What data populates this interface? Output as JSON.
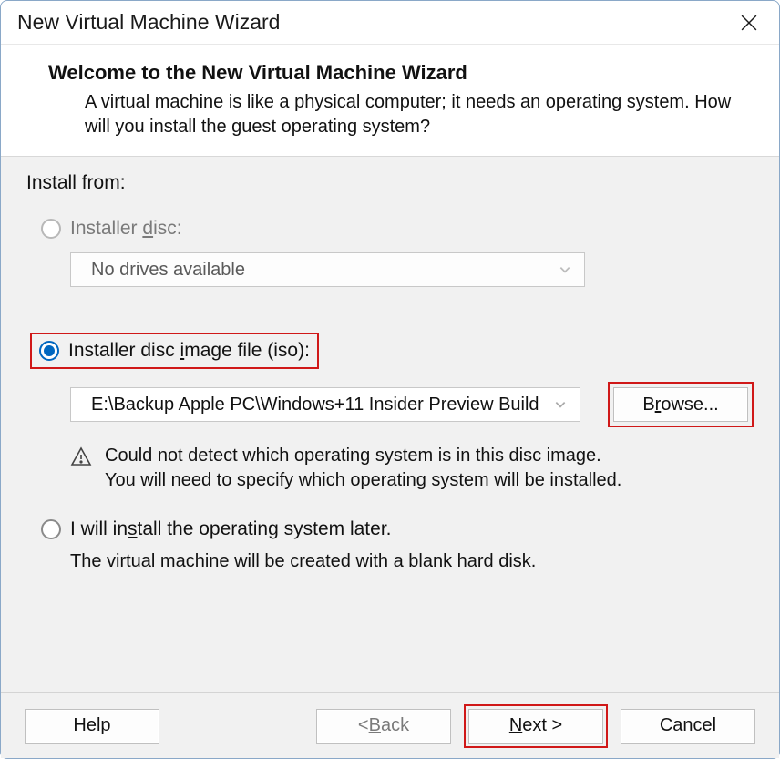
{
  "window": {
    "title": "New Virtual Machine Wizard"
  },
  "header": {
    "title": "Welcome to the New Virtual Machine Wizard",
    "description": "A virtual machine is like a physical computer; it needs an operating system. How will you install the guest operating system?"
  },
  "content": {
    "install_from_label": "Install from:",
    "disc": {
      "label_pre": "Installer ",
      "label_ul": "d",
      "label_post": "isc:",
      "select_value": "No drives available"
    },
    "iso": {
      "label_pre": "Installer disc ",
      "label_ul": "i",
      "label_post": "mage file (iso):",
      "select_value": "E:\\Backup Apple PC\\Windows+11 Insider Preview Build",
      "browse_pre": "B",
      "browse_ul": "r",
      "browse_post": "owse...",
      "warn_line1": "Could not detect which operating system is in this disc image.",
      "warn_line2": "You will need to specify which operating system will be installed."
    },
    "later": {
      "label_pre": "I will in",
      "label_ul": "s",
      "label_post": "tall the operating system later.",
      "info": "The virtual machine will be created with a blank hard disk."
    }
  },
  "footer": {
    "help": "Help",
    "back_pre": "< ",
    "back_ul": "B",
    "back_post": "ack",
    "next_ul": "N",
    "next_post": "ext >",
    "cancel": "Cancel"
  }
}
